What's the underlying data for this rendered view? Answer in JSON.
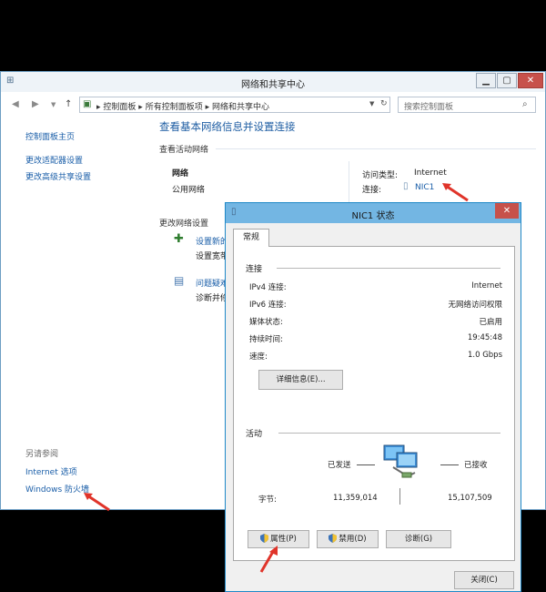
{
  "window": {
    "title": "网络和共享中心",
    "controls": {
      "minimize": "▁",
      "maximize": "▢",
      "close": "✕"
    }
  },
  "nav": {
    "back_icon": "left-arrow-icon",
    "breadcrumb": [
      "控制面板",
      "所有控制面板项",
      "网络和共享中心"
    ],
    "breadcrumb_sep": "▸",
    "search_placeholder": "搜索控制面板"
  },
  "sidebar": {
    "home": "控制面板主页",
    "items": [
      "更改适配器设置",
      "更改高级共享设置"
    ],
    "see_also_heading": "另请参阅",
    "see_also": [
      "Internet 选项",
      "Windows 防火墙"
    ]
  },
  "main": {
    "title": "查看基本网络信息并设置连接",
    "active_heading": "查看活动网络",
    "network_name": "网络",
    "network_type": "公用网络",
    "access_type_label": "访问类型:",
    "access_type_value": "Internet",
    "connection_label": "连接:",
    "connection_value": "NIC1",
    "change_heading": "更改网络设置",
    "setup_link_partial": "设置新的",
    "setup_desc_partial": "设置宽带",
    "trouble_link_partial": "问题疑难",
    "trouble_desc_partial": "诊断并修"
  },
  "dialog": {
    "title": "NIC1 状态",
    "close": "✕",
    "tab": "常规",
    "connection_group": "连接",
    "rows": [
      {
        "label": "IPv4 连接:",
        "value": "Internet"
      },
      {
        "label": "IPv6 连接:",
        "value": "无网络访问权限"
      },
      {
        "label": "媒体状态:",
        "value": "已启用"
      },
      {
        "label": "持续时间:",
        "value": "19:45:48"
      },
      {
        "label": "速度:",
        "value": "1.0 Gbps"
      }
    ],
    "details_button": "详细信息(E)...",
    "activity_group": "活动",
    "sent_label": "已发送",
    "received_label": "已接收",
    "bytes_label": "字节:",
    "bytes_sent": "11,359,014",
    "bytes_received": "15,107,509",
    "buttons": {
      "properties": "属性(P)",
      "disable": "禁用(D)",
      "diagnose": "诊断(G)",
      "close": "关闭(C)"
    }
  },
  "colors": {
    "accent": "#1f88c7",
    "link": "#1a5ea8",
    "arrow": "#e0342a"
  }
}
